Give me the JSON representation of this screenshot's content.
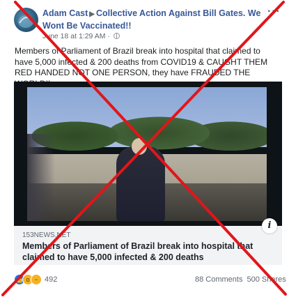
{
  "post": {
    "author": "Adam Cast",
    "group": "Collective Action Against Bill Gates. We Wont Be Vaccinated!!",
    "timestamp": "June 18 at 1:29 AM",
    "more_icon": "more-options-icon",
    "body": "Members of Parliament of Brazil break into hospital that claimed to have 5,000 infected & 200 deaths from COVID19 & CAUGHT THEM RED HANDED NOT ONE PERSON, they have FRAUDED THE WORLD!!"
  },
  "link_preview": {
    "domain": "153NEWS.NET",
    "title": "Members of Parliament of Brazil break into hospital that claimed to have 5,000 infected & 200 deaths",
    "info_label": "i"
  },
  "engagement": {
    "reaction_count": "492",
    "comments": "88 Comments",
    "shares": "500 Shares",
    "reaction_icons": [
      "like-icon",
      "wow-icon",
      "haha-icon"
    ]
  },
  "colors": {
    "link_blue": "#385898",
    "cross_red": "#e0161b"
  }
}
